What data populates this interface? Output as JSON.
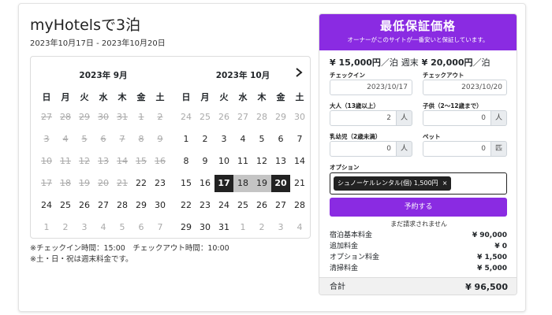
{
  "header": {
    "title": "myHotelsで3泊",
    "dates": "2023年10月17日 - 2023年10月20日"
  },
  "calendar": {
    "weekdays": [
      "日",
      "月",
      "火",
      "水",
      "木",
      "金",
      "土"
    ],
    "months": [
      {
        "title": "2023年 9月",
        "weeks": [
          [
            "27",
            "28",
            "29",
            "30",
            "31",
            "1",
            "2"
          ],
          [
            "3",
            "4",
            "5",
            "6",
            "7",
            "8",
            "9"
          ],
          [
            "10",
            "11",
            "12",
            "13",
            "14",
            "15",
            "16"
          ],
          [
            "17",
            "18",
            "19",
            "20",
            "21",
            "22",
            "23"
          ],
          [
            "24",
            "25",
            "26",
            "27",
            "28",
            "29",
            "30"
          ],
          [
            "1",
            "2",
            "3",
            "4",
            "5",
            "6",
            "7"
          ]
        ]
      },
      {
        "title": "2023年 10月",
        "weeks": [
          [
            "24",
            "25",
            "26",
            "27",
            "28",
            "29",
            "30"
          ],
          [
            "1",
            "2",
            "3",
            "4",
            "5",
            "6",
            "7"
          ],
          [
            "8",
            "9",
            "10",
            "11",
            "12",
            "13",
            "14"
          ],
          [
            "15",
            "16",
            "17",
            "18",
            "19",
            "20",
            "21"
          ],
          [
            "22",
            "23",
            "24",
            "25",
            "26",
            "27",
            "28"
          ],
          [
            "29",
            "30",
            "31",
            "1",
            "2",
            "3",
            "4"
          ]
        ]
      }
    ],
    "next_icon": "chevron-right-icon"
  },
  "notes": {
    "checkin_checkout": "※チェックイン時間：15:00　チェックアウト時間：10:00",
    "weekend": "※土・日・祝は週末料金です。"
  },
  "booking": {
    "banner_title": "最低保証価格",
    "banner_subtitle": "オーナーがこのサイトが一番安いと保証しています。",
    "price_weekday": "¥ 15,000円",
    "per_night": "／泊",
    "weekend_label": "週末",
    "price_weekend": "¥ 20,000円",
    "checkin_label": "チェックイン",
    "checkin_value": "2023/10/17",
    "checkout_label": "チェックアウト",
    "checkout_value": "2023/10/20",
    "adults_label": "大人（13歳以上）",
    "adults_value": "2",
    "adults_unit": "人",
    "children_label": "子供（2〜12歳まで）",
    "children_value": "0",
    "children_unit": "人",
    "infants_label": "乳幼児（2歳未満）",
    "infants_value": "0",
    "infants_unit": "人",
    "pets_label": "ペット",
    "pets_value": "0",
    "pets_unit": "匹",
    "options_label": "オプション",
    "option_chip": "シュノーケルレンタル(個) 1,500円",
    "option_remove": "×",
    "reserve_button": "予約する",
    "not_charged": "まだ請求されません",
    "fees": [
      {
        "label": "宿泊基本料金",
        "amount": "¥ 90,000"
      },
      {
        "label": "追加料金",
        "amount": "¥ 0"
      },
      {
        "label": "オプション料金",
        "amount": "¥ 1,500"
      },
      {
        "label": "清掃料金",
        "amount": "¥ 5,000"
      }
    ],
    "total_label": "合計",
    "total_amount": "¥ 96,500"
  },
  "colors": {
    "accent": "#8a2be2",
    "selected": "#222222",
    "range": "#c4c4c4"
  }
}
